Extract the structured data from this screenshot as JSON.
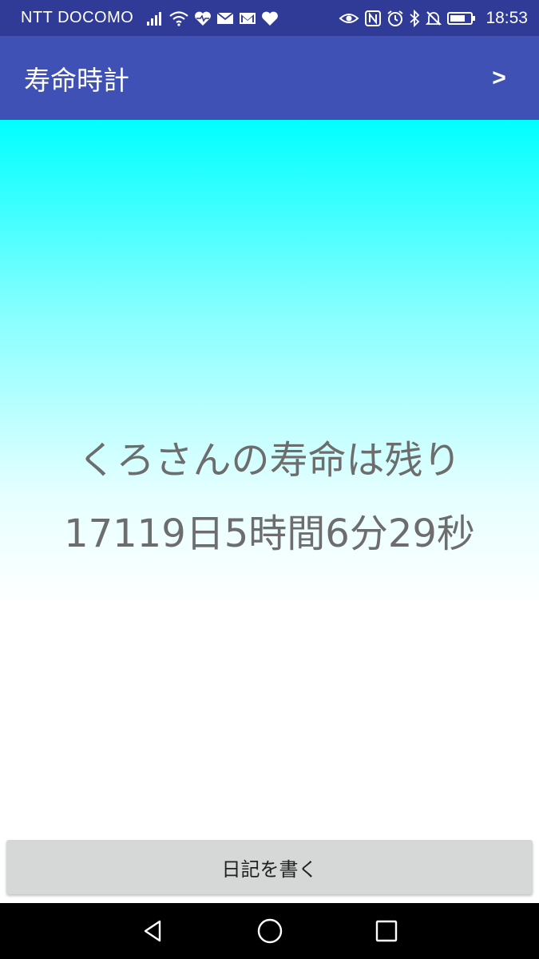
{
  "status_bar": {
    "carrier": "NTT DOCOMO",
    "time": "18:53",
    "left_icons": [
      "signal-icon",
      "wifi-icon",
      "heart-rate-icon",
      "mail-icon",
      "gmail-icon",
      "heart-icon"
    ],
    "right_icons": [
      "eye-comfort-icon",
      "nfc-icon",
      "alarm-icon",
      "bluetooth-icon",
      "mute-icon",
      "battery-icon"
    ],
    "background": "#2f3b96"
  },
  "app_bar": {
    "title": "寿命時計",
    "next_label": ">",
    "background": "#3f51b5"
  },
  "main": {
    "line1": "くろさんの寿命は残り",
    "line2": "17119日5時間6分29秒",
    "gradient_top": "#00ffff",
    "gradient_bottom": "#ffffff",
    "text_color": "#6d6d6d"
  },
  "diary_button": {
    "label": "日記を書く"
  },
  "nav_bar": {
    "buttons": [
      "back-icon",
      "home-icon",
      "recents-icon"
    ]
  }
}
